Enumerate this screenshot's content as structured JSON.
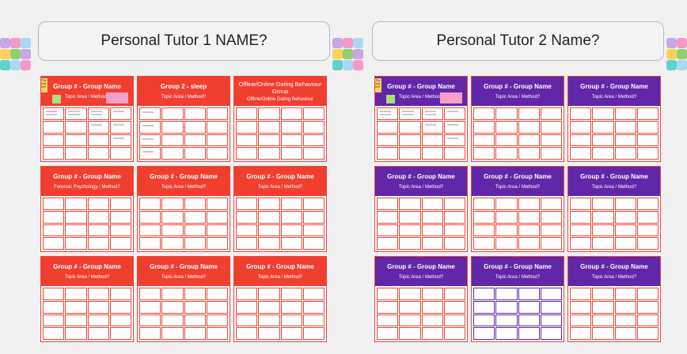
{
  "tutors": [
    {
      "header": "Personal Tutor 1 NAME?",
      "color": "#f03e2f",
      "border": "#e8483a",
      "groups": [
        {
          "title": "Group # - Group Name",
          "subtitle": "Topic Area / Method?"
        },
        {
          "title": "Group 2 - sleep",
          "subtitle": "Topic Area / Method?"
        },
        {
          "title": "Offline/Online Dating Behaviour Group",
          "subtitle": "Offline/Online Dating Behaviour"
        },
        {
          "title": "Group # - Group Name",
          "subtitle": "Forensic Psychology / Method?"
        },
        {
          "title": "Group # - Group Name",
          "subtitle": "Topic Area / Method?"
        },
        {
          "title": "Group # - Group Name",
          "subtitle": "Topic Area / Method?"
        },
        {
          "title": "Group # - Group Name",
          "subtitle": "Topic Area / Method?"
        },
        {
          "title": "Group # - Group Name",
          "subtitle": "Topic Area / Method?"
        },
        {
          "title": "Group # - Group Name",
          "subtitle": "Topic Area / Method?"
        }
      ],
      "example_sticky": "e.g. The Memory Makers!"
    },
    {
      "header": "Personal Tutor 2 Name?",
      "color": "#6226a8",
      "border": "#e8483a",
      "groups": [
        {
          "title": "Group # - Group Name",
          "subtitle": "Topic Area / Method?"
        },
        {
          "title": "Group # - Group Name",
          "subtitle": "Topic Area / Method?"
        },
        {
          "title": "Group # - Group Name",
          "subtitle": "Topic Area / Method?"
        },
        {
          "title": "Group # - Group Name",
          "subtitle": "Topic Area / Method?"
        },
        {
          "title": "Group # - Group Name",
          "subtitle": "Topic Area / Method?"
        },
        {
          "title": "Group # - Group Name",
          "subtitle": "Topic Area / Method?"
        },
        {
          "title": "Group # - Group Name",
          "subtitle": "Topic Area / Method?"
        },
        {
          "title": "Group # - Group Name",
          "subtitle": "Topic Area / Method?"
        },
        {
          "title": "Group # - Group Name",
          "subtitle": "Topic Area / Method?"
        }
      ],
      "example_sticky": "e.g. The Memory Makers!"
    }
  ],
  "sticky_colors": [
    "#c9a6e8",
    "#f59ac4",
    "#a9d8f5",
    "#f7d35a",
    "#8fd16c",
    "#5fd3c9",
    "#f5a06a"
  ]
}
